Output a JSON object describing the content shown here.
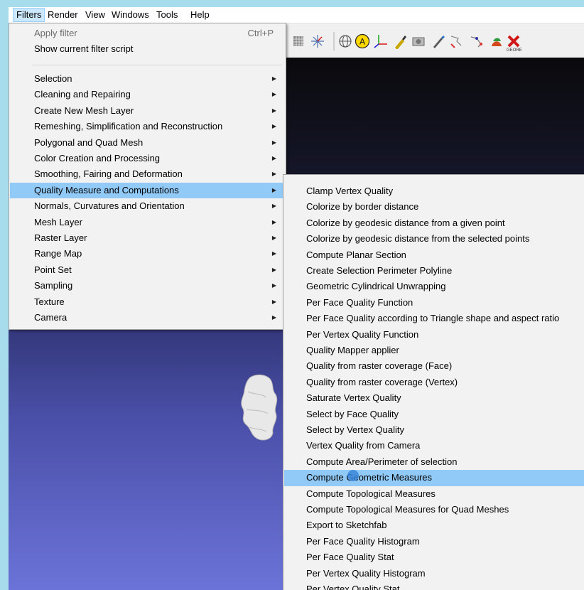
{
  "menubar": {
    "items": [
      "Filters",
      "Render",
      "View",
      "Windows",
      "Tools",
      "Help"
    ],
    "active": "Filters"
  },
  "toolbar": {
    "icons": [
      "box-icon",
      "axes-star-icon",
      "globe-icon",
      "annotation-a-icon",
      "axis-icon",
      "paint-icon",
      "camera-icon",
      "brush-icon",
      "select-icon",
      "select-vertex-icon",
      "fruit-icon",
      "georef-icon"
    ],
    "georef_label": "GEORE"
  },
  "filters_menu": {
    "top_items": [
      {
        "label": "Apply filter",
        "shortcut": "Ctrl+P",
        "disabled": true
      },
      {
        "label": "Show current filter script",
        "shortcut": "",
        "disabled": false
      }
    ],
    "categories": [
      "Selection",
      "Cleaning and Repairing",
      "Create New Mesh Layer",
      "Remeshing, Simplification and Reconstruction",
      "Polygonal and Quad Mesh",
      "Color Creation and Processing",
      "Smoothing, Fairing and Deformation",
      "Quality Measure and Computations",
      "Normals, Curvatures and Orientation",
      "Mesh Layer",
      "Raster Layer",
      "Range Map",
      "Point Set",
      "Sampling",
      "Texture",
      "Camera"
    ],
    "highlighted_category": "Quality Measure and Computations"
  },
  "submenu": {
    "items": [
      "Clamp Vertex Quality",
      "Colorize by border distance",
      "Colorize by geodesic distance from a given point",
      "Colorize by geodesic distance from the selected points",
      "Compute Planar Section",
      "Create Selection Perimeter Polyline",
      "Geometric Cylindrical Unwrapping",
      "Per Face Quality Function",
      "Per Face Quality according to Triangle shape and aspect ratio",
      "Per Vertex Quality Function",
      "Quality Mapper applier",
      "Quality from raster coverage (Face)",
      "Quality from raster coverage (Vertex)",
      "Saturate Vertex Quality",
      "Select by Face Quality",
      "Select by Vertex Quality",
      "Vertex Quality from Camera",
      "Compute Area/Perimeter of selection",
      "Compute Geometric Measures",
      "Compute Topological Measures",
      "Compute Topological Measures for Quad Meshes",
      "Export to Sketchfab",
      "Per Face Quality Histogram",
      "Per Face Quality Stat",
      "Per Vertex Quality Histogram",
      "Per Vertex Quality Stat"
    ],
    "highlighted": "Compute Geometric Measures"
  },
  "colors": {
    "highlight": "#91c9f7",
    "menu_bg": "#f2f2f2",
    "screen_border": "#a7dcec"
  }
}
